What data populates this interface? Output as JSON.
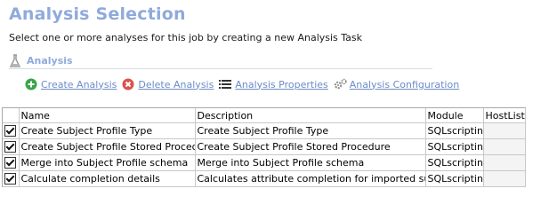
{
  "header": {
    "title": "Analysis Selection",
    "subtitle": "Select one or more analyses for this job by creating a new Analysis Task"
  },
  "section": {
    "label": "Analysis",
    "icon": "flask-icon"
  },
  "toolbar": {
    "create": {
      "label": "Create Analysis",
      "icon": "add-icon",
      "color": "#3aa44a"
    },
    "delete": {
      "label": "Delete Analysis",
      "icon": "delete-icon",
      "color": "#d9534f"
    },
    "properties": {
      "label": "Analysis Properties",
      "icon": "list-icon"
    },
    "configuration": {
      "label": "Analysis Configuration",
      "icon": "gears-icon"
    }
  },
  "grid": {
    "columns": [
      "Name",
      "Description",
      "Module",
      "HostLists"
    ],
    "rows": [
      {
        "checked": true,
        "name": "Create Subject Profile Type",
        "description": "Create Subject Profile Type",
        "module": "SQLscripting",
        "hostlists": ""
      },
      {
        "checked": true,
        "name": "Create Subject Profile Stored Procedure",
        "description": "Create Subject Profile Stored Procedure",
        "module": "SQLscripting",
        "hostlists": ""
      },
      {
        "checked": true,
        "name": "Merge into Subject Profile schema",
        "description": "Merge into Subject Profile schema",
        "module": "SQLscripting",
        "hostlists": ""
      },
      {
        "checked": true,
        "name": "Calculate completion details",
        "description": "Calculates attribute completion for imported subjects",
        "module": "SQLscripting",
        "hostlists": ""
      }
    ]
  }
}
